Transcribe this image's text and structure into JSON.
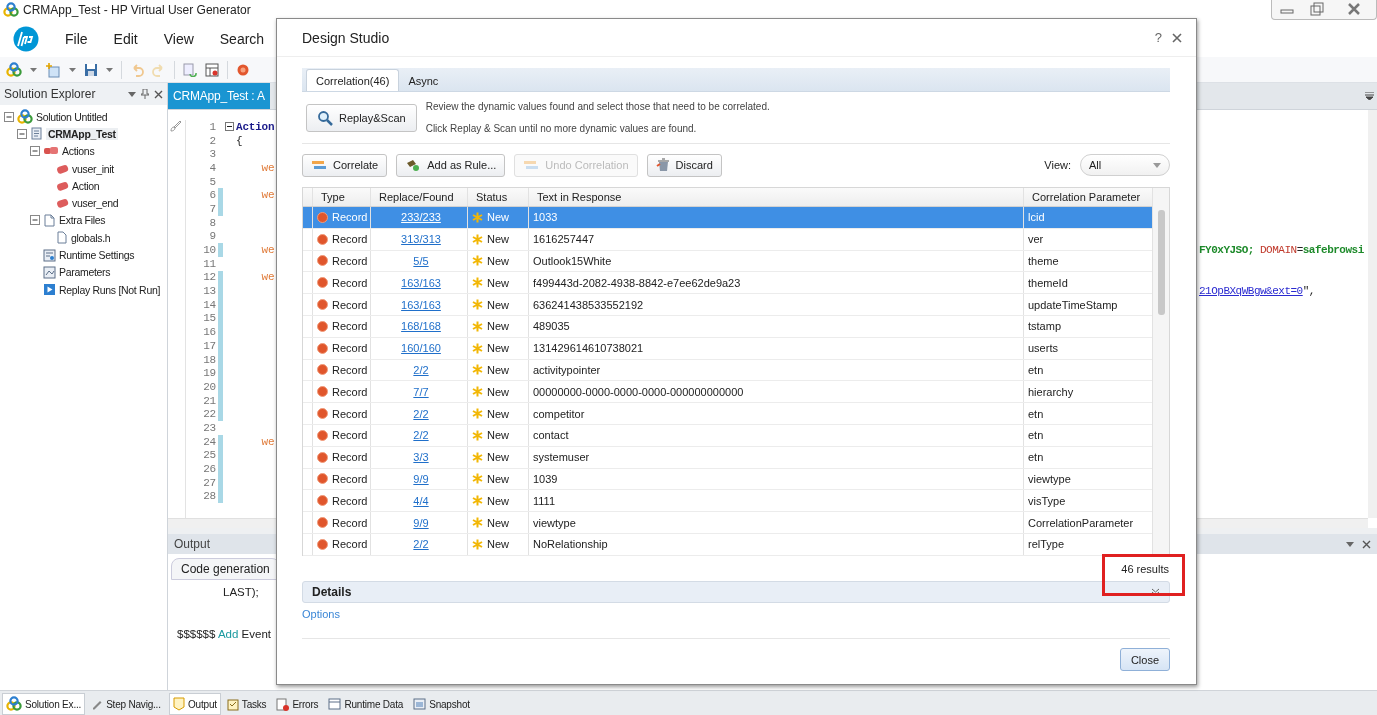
{
  "window": {
    "title": "CRMApp_Test - HP Virtual User Generator"
  },
  "menu": [
    {
      "label": "File"
    },
    {
      "label": "Edit"
    },
    {
      "label": "View"
    },
    {
      "label": "Search"
    }
  ],
  "solution_explorer": {
    "title": "Solution Explorer",
    "tree": [
      {
        "label": "Solution Untitled",
        "kind": "solution",
        "selected": false,
        "expanded": true,
        "children": [
          {
            "label": "CRMApp_Test",
            "kind": "script",
            "selected": true,
            "expanded": true,
            "children": [
              {
                "label": "Actions",
                "kind": "actions",
                "selected": false,
                "expanded": true,
                "children": [
                  {
                    "label": "vuser_init",
                    "kind": "action",
                    "selected": false
                  },
                  {
                    "label": "Action",
                    "kind": "action",
                    "selected": false
                  },
                  {
                    "label": "vuser_end",
                    "kind": "action",
                    "selected": false
                  }
                ]
              },
              {
                "label": "Extra Files",
                "kind": "files",
                "selected": false,
                "expanded": true,
                "children": [
                  {
                    "label": "globals.h",
                    "kind": "file",
                    "selected": false
                  }
                ]
              },
              {
                "label": "Runtime Settings",
                "kind": "settings",
                "selected": false
              },
              {
                "label": "Parameters",
                "kind": "params",
                "selected": false
              },
              {
                "label": "Replay Runs [Not Run]",
                "kind": "runs",
                "selected": false
              }
            ]
          }
        ]
      }
    ]
  },
  "editor": {
    "tab": "CRMApp_Test : A",
    "lines": [
      {
        "number": "1",
        "changed": false,
        "fold": true,
        "code": [
          {
            "text": "Action",
            "kind": "keyword"
          }
        ]
      },
      {
        "number": "2",
        "changed": false,
        "code": [
          {
            "text": "{",
            "kind": "plain"
          }
        ]
      },
      {
        "number": "3",
        "changed": false
      },
      {
        "number": "4",
        "changed": false,
        "code": [
          {
            "text": "    we",
            "kind": "function"
          }
        ]
      },
      {
        "number": "5",
        "changed": false
      },
      {
        "number": "6",
        "changed": true,
        "code": [
          {
            "text": "    we",
            "kind": "function"
          }
        ]
      },
      {
        "number": "7",
        "changed": true
      },
      {
        "number": "8",
        "changed": false
      },
      {
        "number": "9",
        "changed": false
      },
      {
        "number": "10",
        "changed": true,
        "code": [
          {
            "text": "    we",
            "kind": "function"
          }
        ],
        "tail": [
          {
            "text": "FY0xYJSO; ",
            "kind": "string"
          },
          {
            "text": "DOMAIN",
            "kind": "attribute"
          },
          {
            "text": "=",
            "kind": "plain"
          },
          {
            "text": "safebrowsi",
            "kind": "string"
          }
        ]
      },
      {
        "number": "11",
        "changed": false
      },
      {
        "number": "12",
        "changed": true,
        "code": [
          {
            "text": "    we",
            "kind": "function"
          }
        ]
      },
      {
        "number": "13",
        "changed": true,
        "tail": [
          {
            "text": "21OpBXqWBgw&ext=0",
            "kind": "link"
          },
          {
            "text": "\",",
            "kind": "plain"
          }
        ]
      },
      {
        "number": "14",
        "changed": true
      },
      {
        "number": "15",
        "changed": true
      },
      {
        "number": "16",
        "changed": true
      },
      {
        "number": "17",
        "changed": true
      },
      {
        "number": "18",
        "changed": true
      },
      {
        "number": "19",
        "changed": true
      },
      {
        "number": "20",
        "changed": true
      },
      {
        "number": "21",
        "changed": true
      },
      {
        "number": "22",
        "changed": true
      },
      {
        "number": "23",
        "changed": false
      },
      {
        "number": "24",
        "changed": true,
        "code": [
          {
            "text": "    we",
            "kind": "function"
          }
        ]
      },
      {
        "number": "25",
        "changed": true
      },
      {
        "number": "26",
        "changed": true
      },
      {
        "number": "27",
        "changed": true
      },
      {
        "number": "28",
        "changed": true
      }
    ]
  },
  "output": {
    "title": "Output",
    "tab": "Code generation",
    "lines": [
      {
        "kind": "continuation",
        "segments": [
          {
            "text": "LAST);",
            "kind": "plain"
          }
        ]
      },
      {
        "kind": "message",
        "segments": [
          {
            "text": "$$$$$$ ",
            "kind": "plain"
          },
          {
            "text": "Add",
            "kind": "keyword"
          },
          {
            "text": " Event",
            "kind": "plain"
          }
        ]
      }
    ]
  },
  "bottom_tabs": {
    "left": [
      {
        "label": "Solution Ex...",
        "kind": "solution",
        "selected": true
      },
      {
        "label": "Step Navig...",
        "kind": "steps",
        "selected": false
      }
    ],
    "right": [
      {
        "label": "Output",
        "kind": "output",
        "selected": true
      },
      {
        "label": "Tasks",
        "kind": "tasks",
        "selected": false
      },
      {
        "label": "Errors",
        "kind": "errors",
        "selected": false
      },
      {
        "label": "Runtime Data",
        "kind": "runtime",
        "selected": false
      },
      {
        "label": "Snapshot",
        "kind": "snapshot",
        "selected": false
      }
    ]
  },
  "dialog": {
    "title": "Design Studio",
    "help": "?",
    "tabs": [
      {
        "label": "Correlation(46)",
        "selected": true
      },
      {
        "label": "Async",
        "selected": false
      }
    ],
    "scan_button": "Replay&Scan",
    "hints": [
      "Review the dynamic values found and select those that need to be correlated.",
      "Click Replay & Scan until no more dynamic values are found."
    ],
    "actions": [
      {
        "label": "Correlate",
        "kind": "correlate",
        "disabled": false
      },
      {
        "label": "Add as Rule...",
        "kind": "rule",
        "disabled": false
      },
      {
        "label": "Undo Correlation",
        "kind": "undo",
        "disabled": true
      },
      {
        "label": "Discard",
        "kind": "discard",
        "disabled": false
      }
    ],
    "view": {
      "label": "View:",
      "value": "All"
    },
    "table": {
      "columns": [
        "Type",
        "Replace/Found",
        "Status",
        "Text in Response",
        "Correlation Parameter"
      ],
      "rows": [
        {
          "type": "Record",
          "found": "233/233",
          "status": "New",
          "text": "1033",
          "parameter": "lcid",
          "selected": true
        },
        {
          "type": "Record",
          "found": "313/313",
          "status": "New",
          "text": "1616257447",
          "parameter": "ver",
          "selected": false
        },
        {
          "type": "Record",
          "found": "5/5",
          "status": "New",
          "text": "Outlook15White",
          "parameter": "theme",
          "selected": false
        },
        {
          "type": "Record",
          "found": "163/163",
          "status": "New",
          "text": "f499443d-2082-4938-8842-e7ee62de9a23",
          "parameter": "themeId",
          "selected": false
        },
        {
          "type": "Record",
          "found": "163/163",
          "status": "New",
          "text": "636241438533552192",
          "parameter": "updateTimeStamp",
          "selected": false
        },
        {
          "type": "Record",
          "found": "168/168",
          "status": "New",
          "text": "489035",
          "parameter": "tstamp",
          "selected": false
        },
        {
          "type": "Record",
          "found": "160/160",
          "status": "New",
          "text": "131429614610738021",
          "parameter": "userts",
          "selected": false
        },
        {
          "type": "Record",
          "found": "2/2",
          "status": "New",
          "text": "activitypointer",
          "parameter": "etn",
          "selected": false
        },
        {
          "type": "Record",
          "found": "7/7",
          "status": "New",
          "text": "00000000-0000-0000-0000-000000000000",
          "parameter": "hierarchy",
          "selected": false
        },
        {
          "type": "Record",
          "found": "2/2",
          "status": "New",
          "text": "competitor",
          "parameter": "etn",
          "selected": false
        },
        {
          "type": "Record",
          "found": "2/2",
          "status": "New",
          "text": "contact",
          "parameter": "etn",
          "selected": false
        },
        {
          "type": "Record",
          "found": "3/3",
          "status": "New",
          "text": "systemuser",
          "parameter": "etn",
          "selected": false
        },
        {
          "type": "Record",
          "found": "9/9",
          "status": "New",
          "text": "1039",
          "parameter": "viewtype",
          "selected": false
        },
        {
          "type": "Record",
          "found": "4/4",
          "status": "New",
          "text": "1111",
          "parameter": "visType",
          "selected": false
        },
        {
          "type": "Record",
          "found": "9/9",
          "status": "New",
          "text": "viewtype",
          "parameter": "CorrelationParameter",
          "selected": false
        },
        {
          "type": "Record",
          "found": "2/2",
          "status": "New",
          "text": "NoRelationship",
          "parameter": "relType",
          "selected": false
        }
      ]
    },
    "results": {
      "text": "46 results",
      "highlighted": true
    },
    "details": {
      "title": "Details",
      "expanded": false
    },
    "options_link": "Options",
    "close_button": "Close"
  }
}
